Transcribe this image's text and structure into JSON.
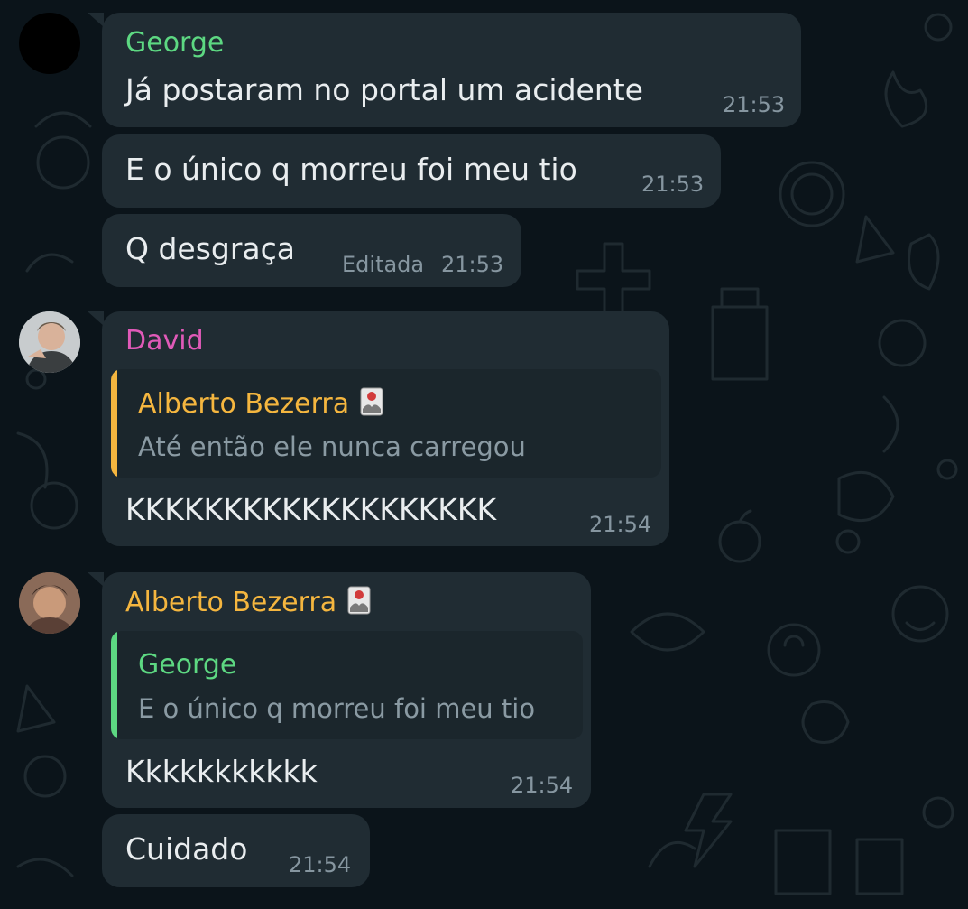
{
  "colors": {
    "george": "#5dd882",
    "david": "#e05ab8",
    "alberto": "#f5b63f",
    "bubble": "#202c33",
    "quote_bg": "#1b262c",
    "time": "#8696a0",
    "text": "#e9edef"
  },
  "messages": [
    {
      "sender": "George",
      "text": "Já postaram no portal um acidente",
      "time": "21:53"
    },
    {
      "text": "E o único q morreu foi meu tio",
      "time": "21:53"
    },
    {
      "text": "Q desgraça",
      "edited_label": "Editada",
      "time": "21:53"
    },
    {
      "sender": "David",
      "quote": {
        "sender": "Alberto Bezerra",
        "sender_badge": "card-emoji-icon",
        "text": "Até então ele nunca carregou"
      },
      "text": "KKKKKKKKKKKKKKKKKKK",
      "time": "21:54"
    },
    {
      "sender": "Alberto Bezerra",
      "sender_badge": "card-emoji-icon",
      "quote": {
        "sender": "George",
        "text": "E o único q morreu foi meu tio"
      },
      "text": "Kkkkkkkkkkk",
      "time": "21:54"
    },
    {
      "text": "Cuidado",
      "time": "21:54"
    }
  ]
}
